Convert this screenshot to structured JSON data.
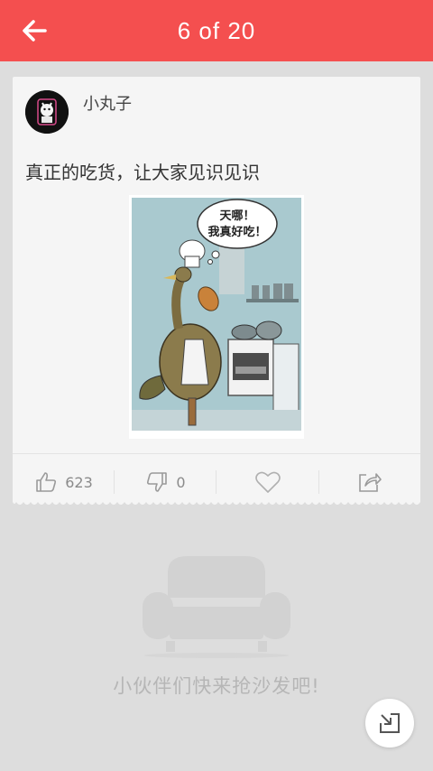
{
  "header": {
    "title": "6 of 20",
    "back_icon": "arrow-left-icon",
    "bg_color": "#f44f4f"
  },
  "post": {
    "author": "小丸子",
    "text": "真正的吃货，让大家见识见识",
    "image": {
      "description_bubble_line1": "天哪！",
      "description_bubble_line2": "我真好吃！"
    },
    "actions": {
      "like_count": "623",
      "dislike_count": "0",
      "like_icon": "thumbs-up-icon",
      "dislike_icon": "thumbs-down-icon",
      "favorite_icon": "heart-icon",
      "share_icon": "share-icon"
    }
  },
  "comments": {
    "empty_icon": "sofa-icon",
    "empty_text": "小伙伴们快来抢沙发吧!"
  },
  "fab": {
    "icon": "shrink-icon"
  }
}
